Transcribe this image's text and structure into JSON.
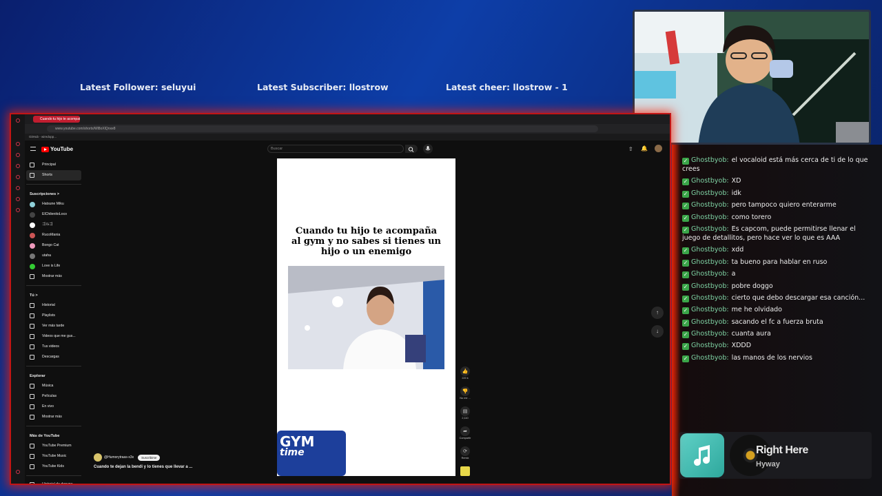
{
  "overlay": {
    "latest_follower": "Latest Follower: seluyui",
    "latest_subscriber": "Latest Subscriber: llostrow",
    "latest_cheer": "Latest cheer: llostrow - 1"
  },
  "browser": {
    "tab_title": "Cuando tu hijo te acompaña...",
    "url": "www.youtube.com/shorts/Wl8oXlQnxe8",
    "bookmark": "GitHub - wiredopp..."
  },
  "youtube": {
    "logo_text": "YouTube",
    "search_placeholder": "Buscar",
    "sidebar": {
      "main": [
        {
          "label": "Principal",
          "icon": "home-icon"
        },
        {
          "label": "Shorts",
          "icon": "shorts-icon"
        }
      ],
      "subscriptions_header": "Suscripciones  >",
      "subscriptions": [
        {
          "label": "Hatsune Miku",
          "color": "#8fd0d8"
        },
        {
          "label": "ElChilenitoLoco",
          "color": "#444"
        },
        {
          "label": "ゴルゴ",
          "color": "#ffffff"
        },
        {
          "label": "RucoMania",
          "color": "#c55"
        },
        {
          "label": "Bongo Cat",
          "color": "#e9b"
        },
        {
          "label": "utaha",
          "color": "#777"
        },
        {
          "label": "Love is Life",
          "color": "#3c3"
        },
        {
          "label": "Mostrar más",
          "color": ""
        }
      ],
      "you_header": "Tú  >",
      "you": [
        {
          "label": "Historial"
        },
        {
          "label": "Playlists"
        },
        {
          "label": "Ver más tarde"
        },
        {
          "label": "Videos que me gus..."
        },
        {
          "label": "Tus videos"
        },
        {
          "label": "Descargas"
        }
      ],
      "explore_header": "Explorar",
      "explore": [
        {
          "label": "Música"
        },
        {
          "label": "Películas"
        },
        {
          "label": "En vivo"
        },
        {
          "label": "Mostrar más"
        }
      ],
      "more_header": "Más de YouTube",
      "more": [
        {
          "label": "YouTube Premium"
        },
        {
          "label": "YouTube Music"
        },
        {
          "label": "YouTube Kids"
        }
      ],
      "report": "Historial de denunc..."
    },
    "short": {
      "caption": "Cuando tu hijo te acompaña al gym y no sabes si tienes un hijo o un enemigo",
      "gym_logo": "GYM",
      "gym_logo_sub": "time"
    },
    "actions": {
      "likes": "220 k",
      "dislike": "No me ...",
      "comments": "2,110",
      "share": "Compartir",
      "remix": "Remix"
    },
    "channel": "@Humorytraas-x3x",
    "subscribe": "Suscribirse",
    "video_title": "Cuando te dejan la bendi y lo tienes que llevar a ..."
  },
  "chat": [
    {
      "user": "Ghostbyob:",
      "msg": "el vocaloid está más cerca de ti de lo que crees"
    },
    {
      "user": "Ghostbyob:",
      "msg": "XD"
    },
    {
      "user": "Ghostbyob:",
      "msg": "idk"
    },
    {
      "user": "Ghostbyob:",
      "msg": "pero tampoco quiero enterarme"
    },
    {
      "user": "Ghostbyob:",
      "msg": "como torero"
    },
    {
      "user": "Ghostbyob:",
      "msg": "Es capcom, puede permitirse llenar el juego de detallitos, pero hace ver lo que es AAA"
    },
    {
      "user": "Ghostbyob:",
      "msg": "xdd"
    },
    {
      "user": "Ghostbyob:",
      "msg": "ta bueno para hablar en ruso"
    },
    {
      "user": "Ghostbyob:",
      "msg": "a"
    },
    {
      "user": "Ghostbyob:",
      "msg": "pobre doggo"
    },
    {
      "user": "Ghostbyob:",
      "msg": "cierto que debo descargar esa canción..."
    },
    {
      "user": "Ghostbyob:",
      "msg": "me he olvidado"
    },
    {
      "user": "Ghostbyob:",
      "msg": "sacando el fc a fuerza bruta"
    },
    {
      "user": "Ghostbyob:",
      "msg": "cuanta aura"
    },
    {
      "user": "Ghostbyob:",
      "msg": "XDDD"
    },
    {
      "user": "Ghostbyob:",
      "msg": "las manos de los nervios"
    }
  ],
  "music": {
    "song": "Right Here",
    "artist": "Hyway",
    "album_color": "#4cc2b8",
    "icon": "music-note-icon"
  },
  "colors": {
    "accent_red": "#c21515",
    "chat_user": "#7fd3a4",
    "youtube_red": "#ff0000"
  }
}
